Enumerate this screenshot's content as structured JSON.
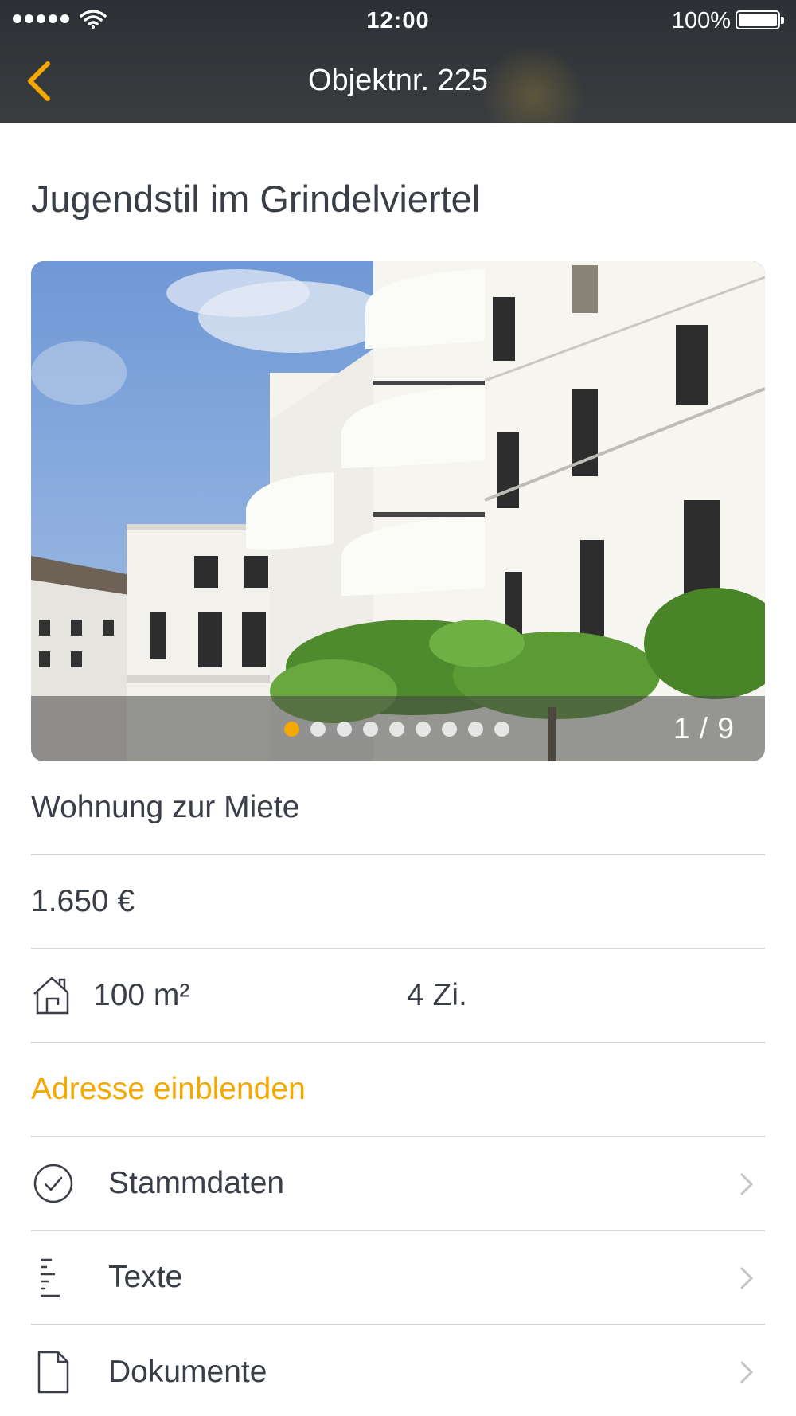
{
  "status_bar": {
    "time": "12:00",
    "battery": "100%"
  },
  "nav": {
    "title": "Objektnr. 225",
    "back_icon": "chevron-left-icon",
    "accent_color": "#f5a800"
  },
  "property": {
    "title": "Jugendstil im Grindelviertel",
    "gallery": {
      "counter": "1 / 9",
      "total_images": 9,
      "active_index": 0
    },
    "type": "Wohnung zur Miete",
    "price": "1.650 €",
    "area": "100 m²",
    "rooms": "4 Zi.",
    "address_link": "Adresse einblenden"
  },
  "menu": {
    "items": [
      {
        "label": "Stammdaten",
        "icon": "check-circle-icon"
      },
      {
        "label": "Texte",
        "icon": "text-lines-icon"
      },
      {
        "label": "Dokumente",
        "icon": "document-icon"
      }
    ]
  }
}
